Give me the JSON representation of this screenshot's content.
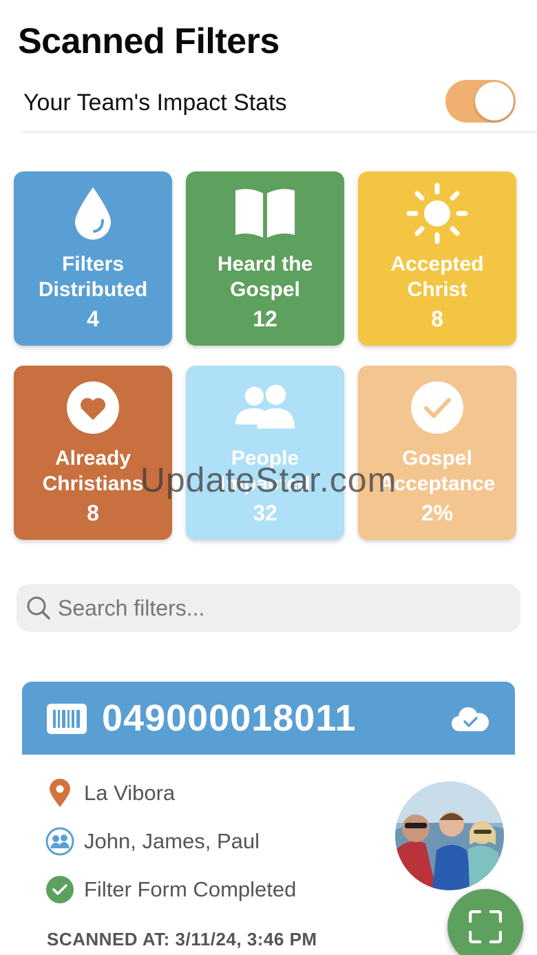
{
  "page": {
    "title": "Scanned Filters"
  },
  "impact": {
    "label": "Your Team's Impact Stats",
    "toggle_on": true
  },
  "stats": [
    {
      "label_line1": "Filters",
      "label_line2": "Distributed",
      "value": "4",
      "color": "#5a9fd4",
      "icon": "water-drop-icon"
    },
    {
      "label_line1": "Heard the",
      "label_line2": "Gospel",
      "value": "12",
      "color": "#5ea05e",
      "icon": "open-book-icon"
    },
    {
      "label_line1": "Accepted",
      "label_line2": "Christ",
      "value": "8",
      "color": "#f4c542",
      "icon": "sun-icon"
    },
    {
      "label_line1": "Already",
      "label_line2": "Christians",
      "value": "8",
      "color": "#c8703f",
      "icon": "heart-circle-icon"
    },
    {
      "label_line1": "People",
      "label_line2": "Impacted",
      "value": "32",
      "color": "#aee0f7",
      "icon": "people-icon"
    },
    {
      "label_line1": "Gospel",
      "label_line2": "Acceptance",
      "value": "2%",
      "color": "#f3c58f",
      "icon": "checkmark-circle-icon"
    }
  ],
  "watermark": "UpdateStar.com",
  "search": {
    "placeholder": "Search filters..."
  },
  "filter": {
    "code": "049000018011",
    "location": "La Vibora",
    "team": "John, James, Paul",
    "status": "Filter Form Completed",
    "scanned_at": "SCANNED AT: 3/11/24, 3:46 PM"
  },
  "colors": {
    "accent_blue": "#5a9fd4",
    "accent_green": "#5ea05e",
    "toggle": "#f1b06f",
    "location_pin": "#d0743c"
  }
}
